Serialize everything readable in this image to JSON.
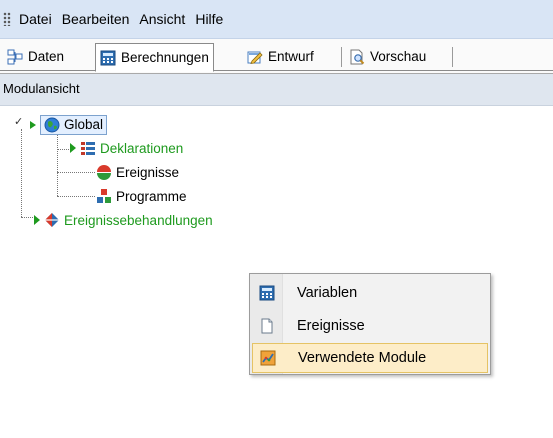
{
  "menubar": {
    "items": [
      "Datei",
      "Bearbeiten",
      "Ansicht",
      "Hilfe"
    ]
  },
  "tabs": [
    {
      "label": "Daten",
      "icon": "data-diagram-icon",
      "active": false
    },
    {
      "label": "Berechnungen",
      "icon": "calculator-icon",
      "active": true
    },
    {
      "label": "Entwurf",
      "icon": "edit-form-icon",
      "active": false
    },
    {
      "label": "Vorschau",
      "icon": "preview-icon",
      "active": false
    }
  ],
  "panel": {
    "title": "Modulansicht"
  },
  "tree": {
    "root": {
      "label": "Global",
      "icon": "globe-icon",
      "expanded": true,
      "selected": true
    },
    "children": [
      {
        "label": "Deklarationen",
        "icon": "declarations-icon",
        "color": "#1e9a1e"
      },
      {
        "label": "Ereignisse",
        "icon": "events-icon",
        "color": "#000000"
      },
      {
        "label": "Programme",
        "icon": "programs-icon",
        "color": "#000000"
      }
    ],
    "sibling": {
      "label": "Ereignissebehandlungen",
      "icon": "event-handlers-icon",
      "color": "#1e9a1e"
    }
  },
  "context_menu": {
    "items": [
      {
        "label": "Variablen",
        "icon": "calculator-icon"
      },
      {
        "label": "Ereignisse",
        "icon": "document-icon"
      },
      {
        "label": "Verwendete Module",
        "icon": "modules-icon",
        "highlighted": true
      }
    ]
  },
  "colors": {
    "menubar_bg": "#d9e5f5",
    "panel_header_bg": "#dfe6ef",
    "tree_green": "#1e9a1e",
    "menu_highlight": "#fdedc8"
  }
}
